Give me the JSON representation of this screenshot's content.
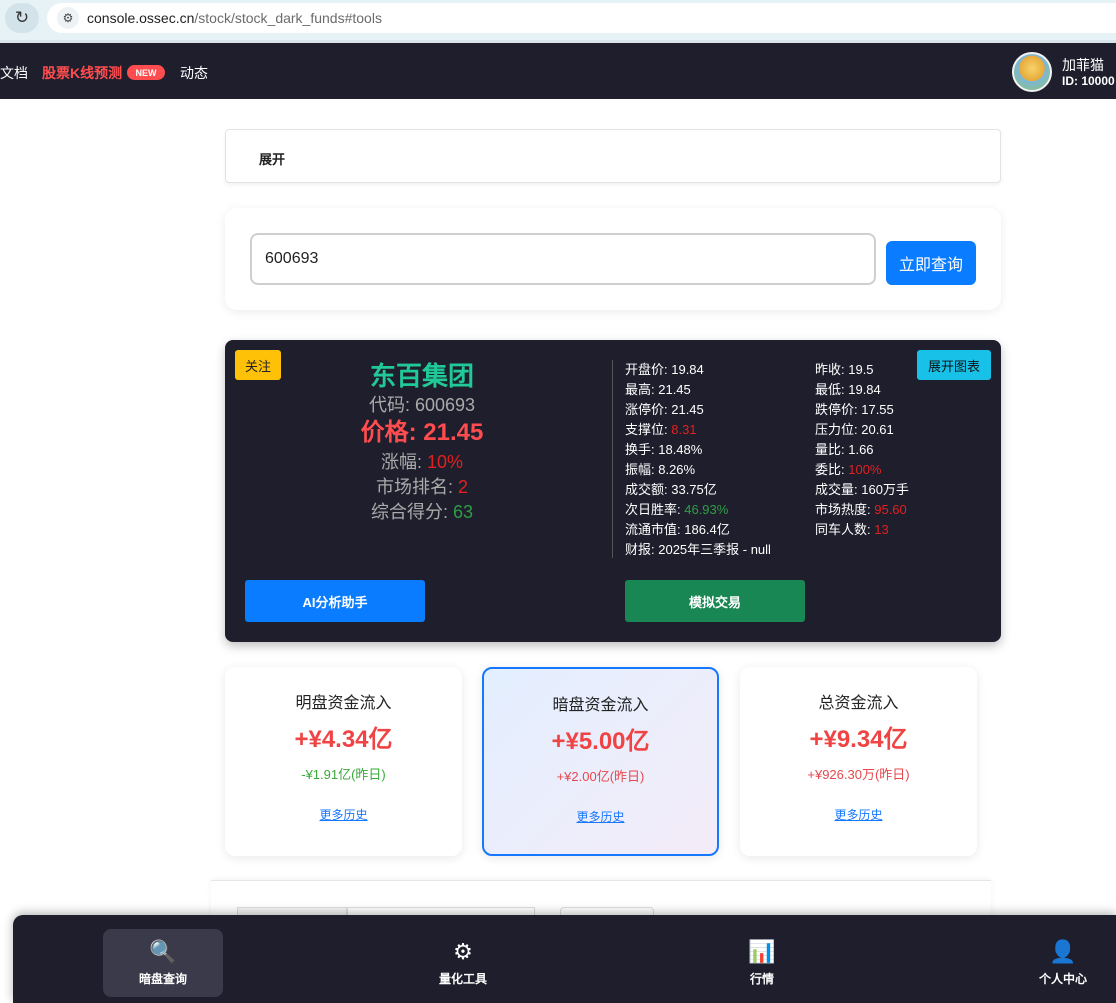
{
  "browser": {
    "url_host": "console.ossec.cn",
    "url_path": "/stock/stock_dark_funds#tools"
  },
  "nav": {
    "docs": "文档",
    "kline": "股票K线预测",
    "new_badge": "NEW",
    "dynamics": "动态",
    "user_name": "加菲猫",
    "user_id": "ID: 10000"
  },
  "expand": {
    "label": "展开"
  },
  "search": {
    "value": "600693",
    "button": "立即查询"
  },
  "stock": {
    "follow": "关注",
    "expand_chart": "展开图表",
    "name": "东百集团",
    "code_label": "代码: ",
    "code": "600693",
    "price_label": "价格: ",
    "price": "21.45",
    "change_label": "涨幅: ",
    "change": "10%",
    "rank_label": "市场排名: ",
    "rank": "2",
    "score_label": "综合得分: ",
    "score": "63",
    "col_a": [
      {
        "label": "开盘价: ",
        "value": "19.84",
        "color": ""
      },
      {
        "label": "最高: ",
        "value": "21.45",
        "color": ""
      },
      {
        "label": "涨停价: ",
        "value": "21.45",
        "color": ""
      },
      {
        "label": "支撑位: ",
        "value": "8.31",
        "color": "red"
      },
      {
        "label": "换手: ",
        "value": "18.48%",
        "color": ""
      },
      {
        "label": "振幅: ",
        "value": "8.26%",
        "color": ""
      },
      {
        "label": "成交额: ",
        "value": "33.75亿",
        "color": ""
      },
      {
        "label": "次日胜率: ",
        "value": "46.93%",
        "color": "green"
      },
      {
        "label": "流通市值: ",
        "value": "186.4亿",
        "color": ""
      },
      {
        "label": "财报: ",
        "value": "2025年三季报 - null",
        "color": ""
      }
    ],
    "col_b": [
      {
        "label": "昨收: ",
        "value": "19.5",
        "color": ""
      },
      {
        "label": "最低: ",
        "value": "19.84",
        "color": ""
      },
      {
        "label": "跌停价: ",
        "value": "17.55",
        "color": ""
      },
      {
        "label": "压力位: ",
        "value": "20.61",
        "color": ""
      },
      {
        "label": "量比: ",
        "value": "1.66",
        "color": ""
      },
      {
        "label": "委比: ",
        "value": "100%",
        "color": "red"
      },
      {
        "label": "成交量: ",
        "value": "160万手",
        "color": ""
      },
      {
        "label": "市场热度: ",
        "value": "95.60",
        "color": "red"
      },
      {
        "label": "同车人数: ",
        "value": "13",
        "color": "red"
      }
    ],
    "ai_button": "AI分析助手",
    "trade_button": "模拟交易"
  },
  "flows": [
    {
      "title": "明盘资金流入",
      "value": "+¥4.34亿",
      "yday": "-¥1.91亿(昨日)",
      "yday_color": "#3aa83a",
      "history": "更多历史"
    },
    {
      "title": "暗盘资金流入",
      "value": "+¥5.00亿",
      "yday": "+¥2.00亿(昨日)",
      "yday_color": "#e5484d",
      "history": "更多历史"
    },
    {
      "title": "总资金流入",
      "value": "+¥9.34亿",
      "yday": "+¥926.30万(昨日)",
      "yday_color": "#e5484d",
      "history": "更多历史"
    }
  ],
  "tabs": [
    {
      "icon": "🔍",
      "label": "暗盘查询"
    },
    {
      "icon": "⚙",
      "label": "量化工具"
    },
    {
      "icon": "📊",
      "label": "行情"
    },
    {
      "icon": "👤",
      "label": "个人中心"
    }
  ]
}
